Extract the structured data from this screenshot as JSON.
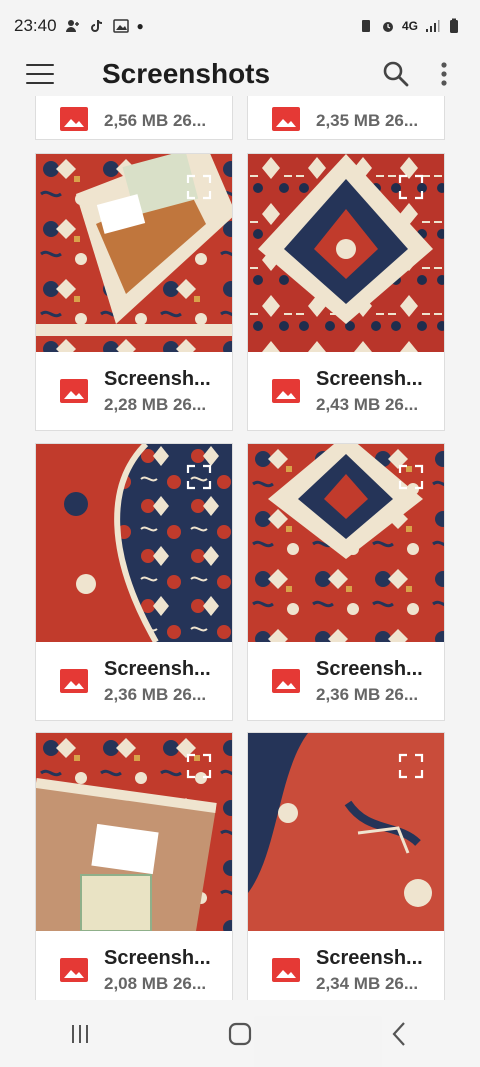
{
  "status": {
    "time": "23:40",
    "network": "4G"
  },
  "appbar": {
    "title": "Screenshots"
  },
  "grid": {
    "top_row": [
      {
        "size": "2,56 MB 26..."
      },
      {
        "size": "2,35 MB 26..."
      }
    ],
    "items": [
      {
        "name": "Screensh...",
        "size": "2,28 MB 26..."
      },
      {
        "name": "Screensh...",
        "size": "2,43 MB 26..."
      },
      {
        "name": "Screensh...",
        "size": "2,36 MB 26..."
      },
      {
        "name": "Screensh...",
        "size": "2,36 MB 26..."
      },
      {
        "name": "Screensh...",
        "size": "2,08 MB 26..."
      },
      {
        "name": "Screensh...",
        "size": "2,34 MB 26..."
      }
    ]
  },
  "colors": {
    "accent": "#e53935",
    "rug_red": "#c13b2c",
    "rug_navy": "#253458",
    "rug_cream": "#efe4cf"
  },
  "icons": [
    "menu-icon",
    "search-icon",
    "more-vert-icon",
    "image-file-icon",
    "expand-icon",
    "recents-icon",
    "home-icon",
    "back-icon"
  ]
}
